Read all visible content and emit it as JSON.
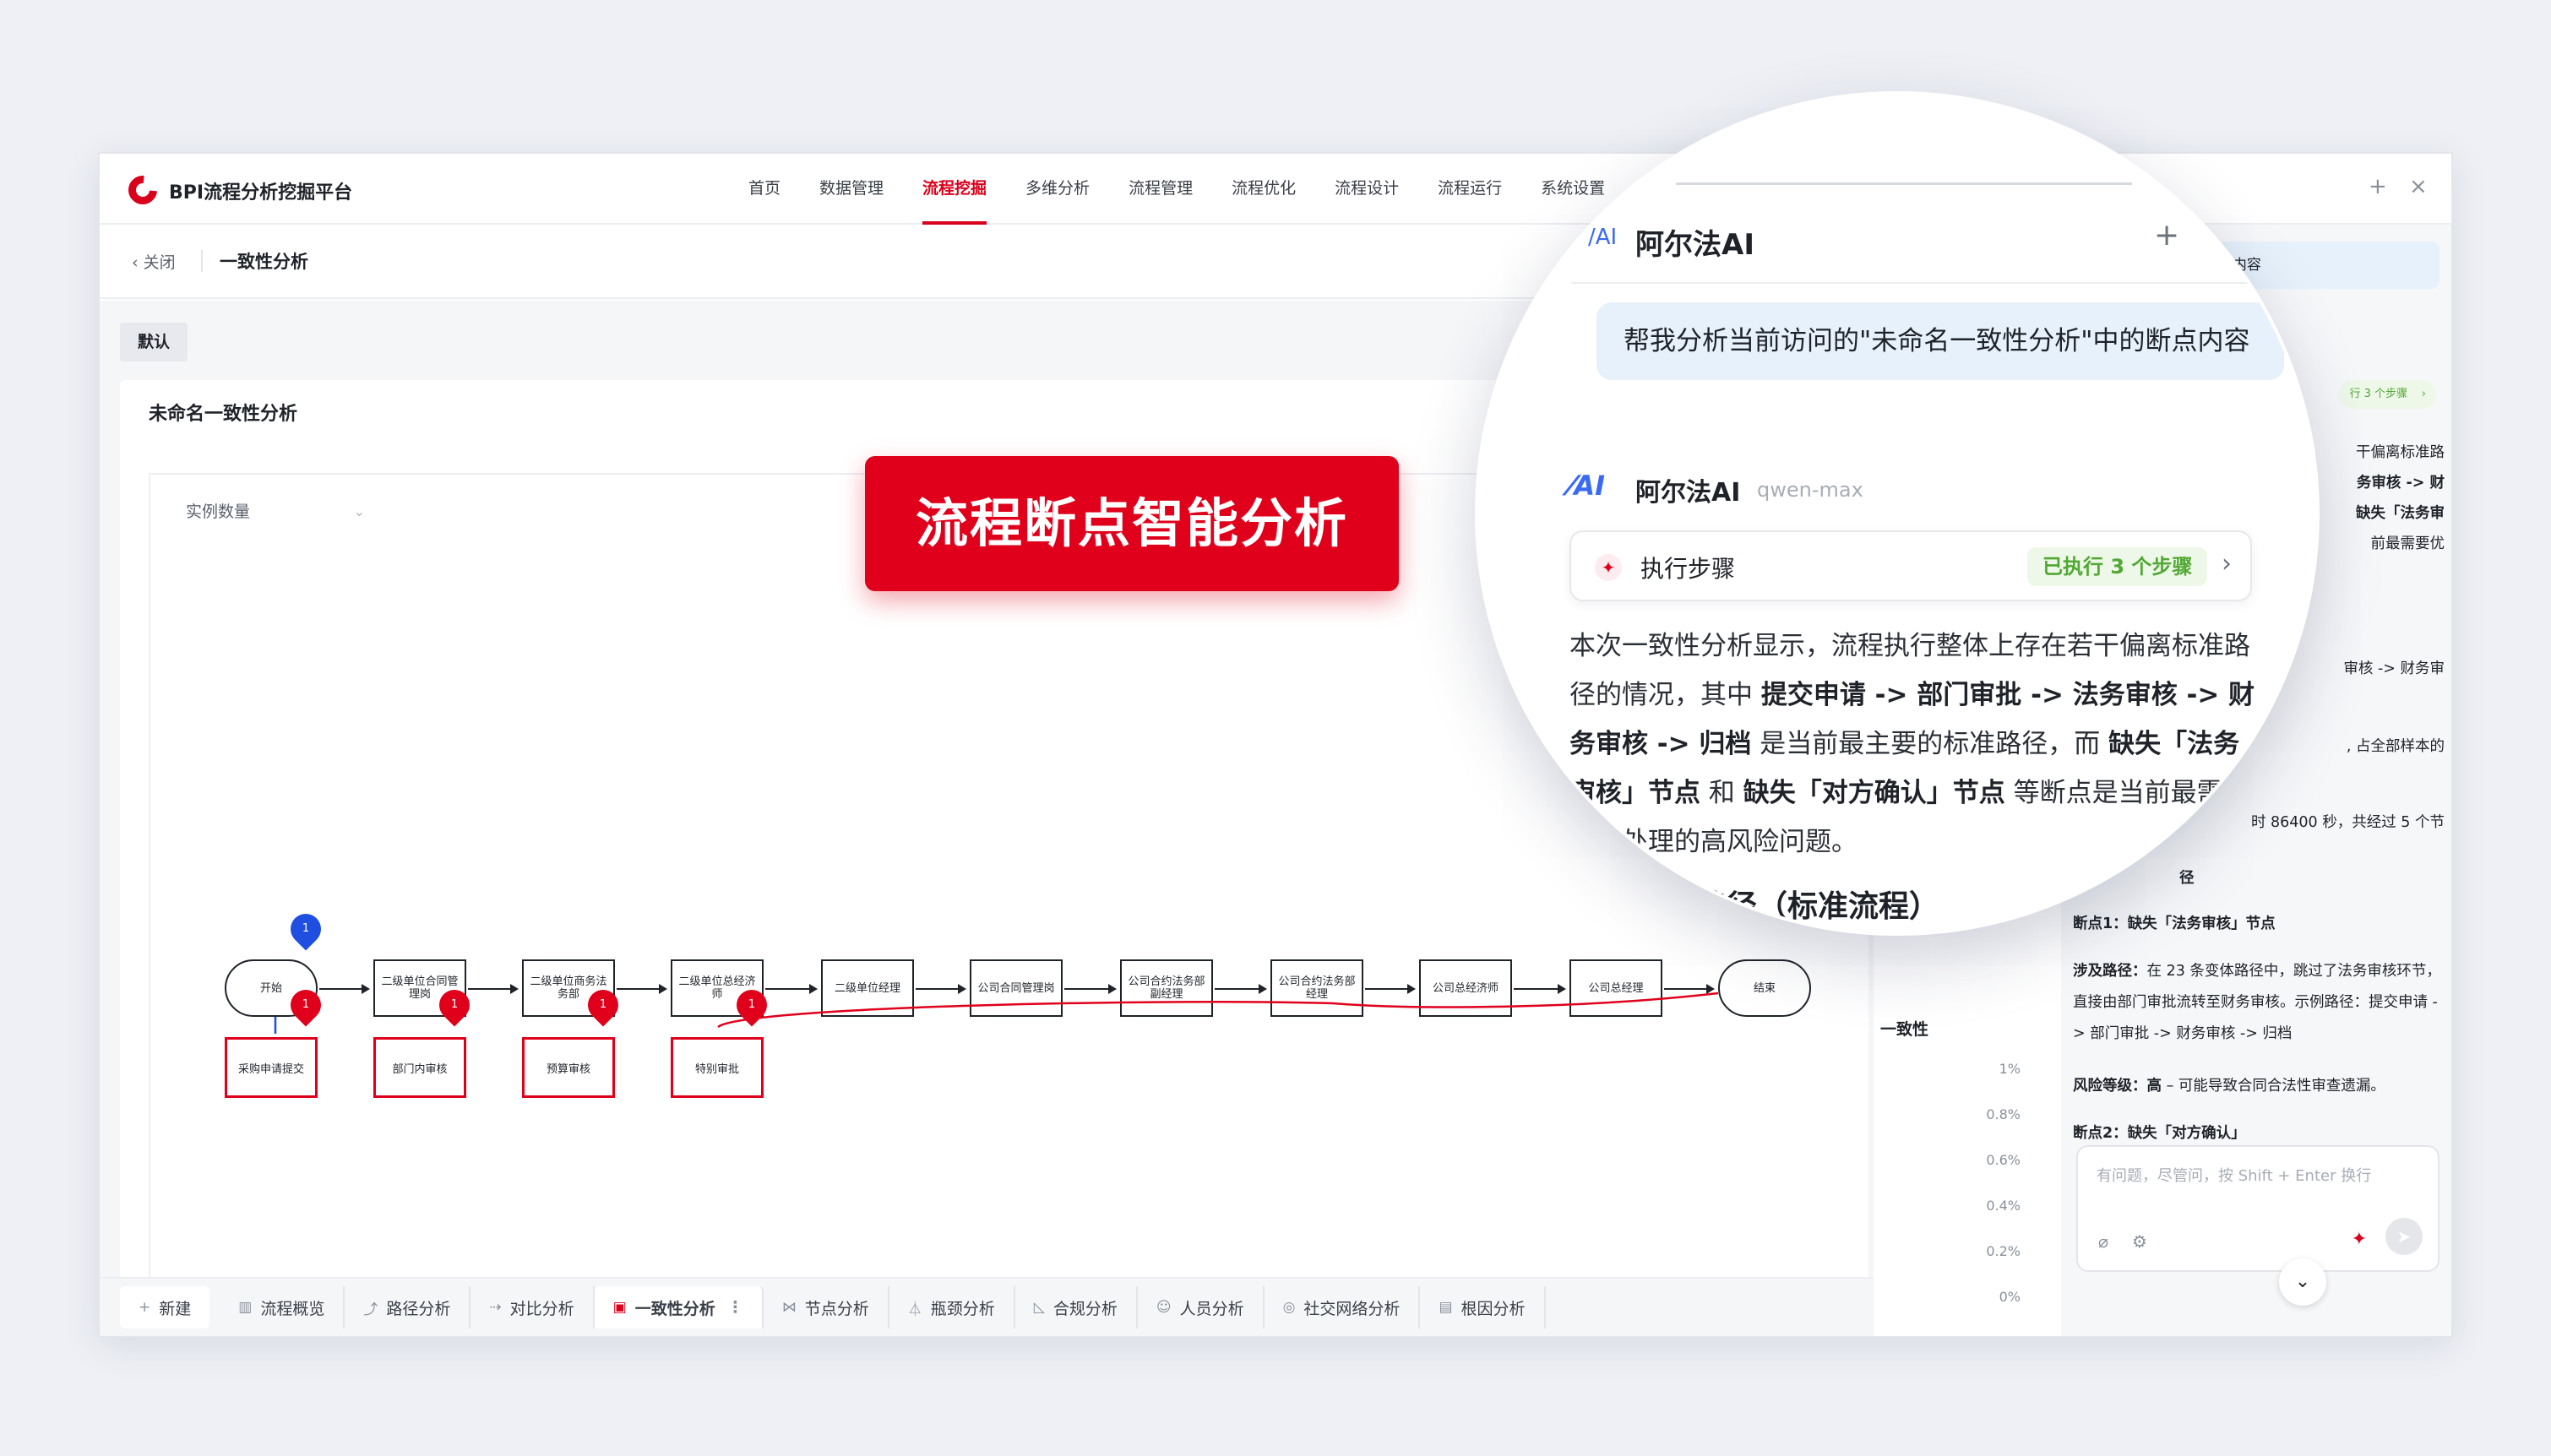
{
  "app": {
    "brand": "BPI流程分析挖掘平台",
    "nav": [
      "首页",
      "数据管理",
      "流程挖掘",
      "多维分析",
      "流程管理",
      "流程优化",
      "流程设计",
      "流程运行",
      "系统设置"
    ],
    "nav_active": "流程挖掘",
    "close_label": "关闭",
    "page_subtitle": "一致性分析"
  },
  "workspace": {
    "tab_default": "默认",
    "panel_title": "未命名一致性分析",
    "metric_select": "实例数量",
    "process_nodes": [
      "开始",
      "二级单位合同管理岗",
      "二级单位商务法务部",
      "二级单位总经济师",
      "二级单位经理",
      "公司合同管理岗",
      "公司合约法务部副经理",
      "公司合约法务部经理",
      "公司总经济师",
      "公司总经理",
      "结束"
    ],
    "deviation_nodes": [
      "采购申请提交",
      "部门内审核",
      "预算审核",
      "特别审批"
    ],
    "pin_label": "1"
  },
  "bottom_tabs": {
    "new_label": "新建",
    "tabs": [
      "流程概览",
      "路径分析",
      "对比分析",
      "一致性分析",
      "节点分析",
      "瓶颈分析",
      "合规分析",
      "人员分析",
      "社交网络分析",
      "根因分析"
    ],
    "active": "一致性分析"
  },
  "side_chart": {
    "title_fragment": "一致性",
    "y_ticks": [
      "1%",
      "0.8%",
      "0.6%",
      "0.4%",
      "0.2%",
      "0%"
    ]
  },
  "chat_panel": {
    "bubble_fragment": "一致性分析\"中的断点内容",
    "pill_fragment": "行 3 个步骤",
    "frag1": "干偏离标准路",
    "frag2": "务审核 -> 财",
    "frag3": "缺失「法务审",
    "frag4": "前最需要优",
    "frag5": "审核 -> 财务审",
    "frag6": ", 占全部样本的",
    "frag7": "时 86400 秒，共经过 5 个节",
    "frag8": "径",
    "break1_label": "断点1：",
    "break1_title": "缺失「法务审核」节点",
    "path_label": "涉及路径：",
    "path_text": "在 23 条变体路径中，跳过了法务审核环节，直接由部门审批流转至财务审核。示例路径：提交申请 -> 部门审批 -> 财务审核 -> 归档",
    "risk_label": "风险等级：",
    "risk_value": "高",
    "risk_text": " – 可能导致合同合法性审查遗漏。",
    "break2_label": "断点2：",
    "break2_title": "缺失「对方确认」",
    "input_placeholder": "有问题，尽管问，按 Shift + Enter 换行"
  },
  "banner": {
    "text": "流程断点智能分析"
  },
  "magnifier": {
    "title": "阿尔法AI",
    "user_message": "帮我分析当前访问的\"未命名一致性分析\"中的断点内容",
    "ai_name": "阿尔法AI",
    "model": "qwen-max",
    "steps_label": "执行步骤",
    "steps_badge": "已执行 3 个步骤",
    "p1": "本次一致性分析显示，流程执行整体上存在若干偏离标准路径的情况，其中 ",
    "p_path": "提交申请 -> 部门审批 -> 法务审核 -> 财务审核 -> 归档",
    "p2": " 是当前最主要的标准路径，而 ",
    "p_b1": "缺失「法务审核」节点",
    "p3": " 和 ",
    "p_b2": "缺失「对方确认」节点",
    "p4": " 等断点是当前最需要优先处理的高风险问题。",
    "heading_fragment": "路径（标准流程）"
  },
  "colors": {
    "brand_red": "#d9001b",
    "pin_blue": "#1f4fe0",
    "success_green": "#52a834",
    "bubble_blue": "#e6f1fb"
  }
}
